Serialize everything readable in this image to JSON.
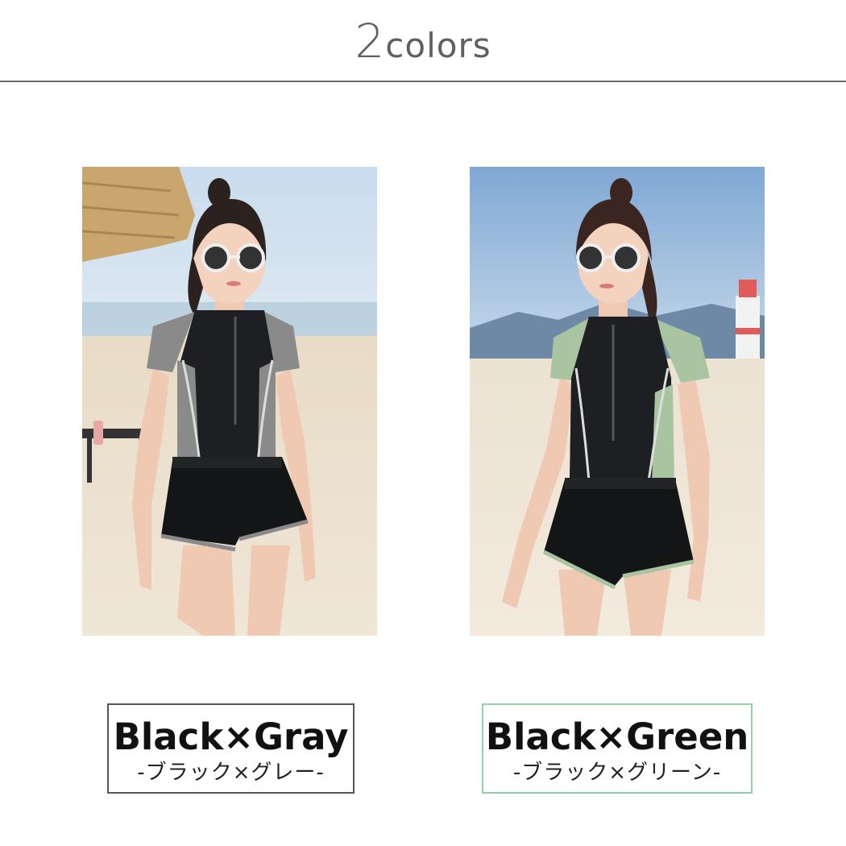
{
  "header": {
    "count": "2",
    "word": "colors"
  },
  "variants": [
    {
      "name_en": "Black×Gray",
      "name_jp": "-ブラック×グレー-",
      "accent_color": "#8a8a8a",
      "box_border_color": "#555555"
    },
    {
      "name_en": "Black×Green",
      "name_jp": "-ブラック×グリーン-",
      "accent_color": "#a9c4a0",
      "box_border_color": "#8fd3a6"
    }
  ]
}
